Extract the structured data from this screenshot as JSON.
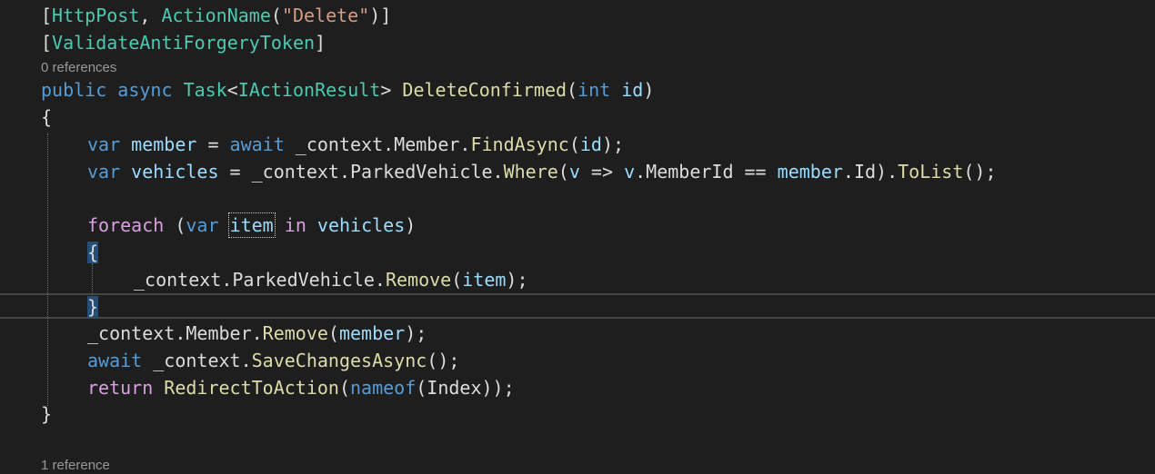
{
  "editor": {
    "codelens_top": "0 references",
    "codelens_bottom": "1 reference",
    "lines": {
      "l1": [
        "[",
        "HttpPost",
        ", ",
        "ActionName",
        "(",
        "\"Delete\"",
        ")]"
      ],
      "l2": [
        "[",
        "ValidateAntiForgeryToken",
        "]"
      ],
      "l3": [
        "public",
        " ",
        "async",
        " ",
        "Task",
        "<",
        "IActionResult",
        "> ",
        "DeleteConfirmed",
        "(",
        "int",
        " ",
        "id",
        ")"
      ],
      "l4": [
        "{"
      ],
      "l5": [
        "var",
        " ",
        "member",
        " = ",
        "await",
        " _context.Member.",
        "FindAsync",
        "(",
        "id",
        ");"
      ],
      "l6": [
        "var",
        " ",
        "vehicles",
        " = _context.ParkedVehicle.",
        "Where",
        "(",
        "v",
        " => ",
        "v",
        ".MemberId == ",
        "member",
        ".Id).",
        "ToList",
        "();"
      ],
      "l7": [
        "foreach",
        " (",
        "var",
        " ",
        "item",
        " in ",
        "vehicles",
        ")"
      ],
      "l8": [
        "{"
      ],
      "l9": [
        "_context.ParkedVehicle.",
        "Remove",
        "(",
        "item",
        ");"
      ],
      "l10": [
        "}"
      ],
      "l11": [
        "_context.Member.",
        "Remove",
        "(",
        "member",
        ");"
      ],
      "l12": [
        "await",
        " _context.",
        "SaveChangesAsync",
        "();"
      ],
      "l13": [
        "return",
        " ",
        "RedirectToAction",
        "(",
        "nameof",
        "(Index));"
      ],
      "l14": [
        "}"
      ]
    }
  }
}
